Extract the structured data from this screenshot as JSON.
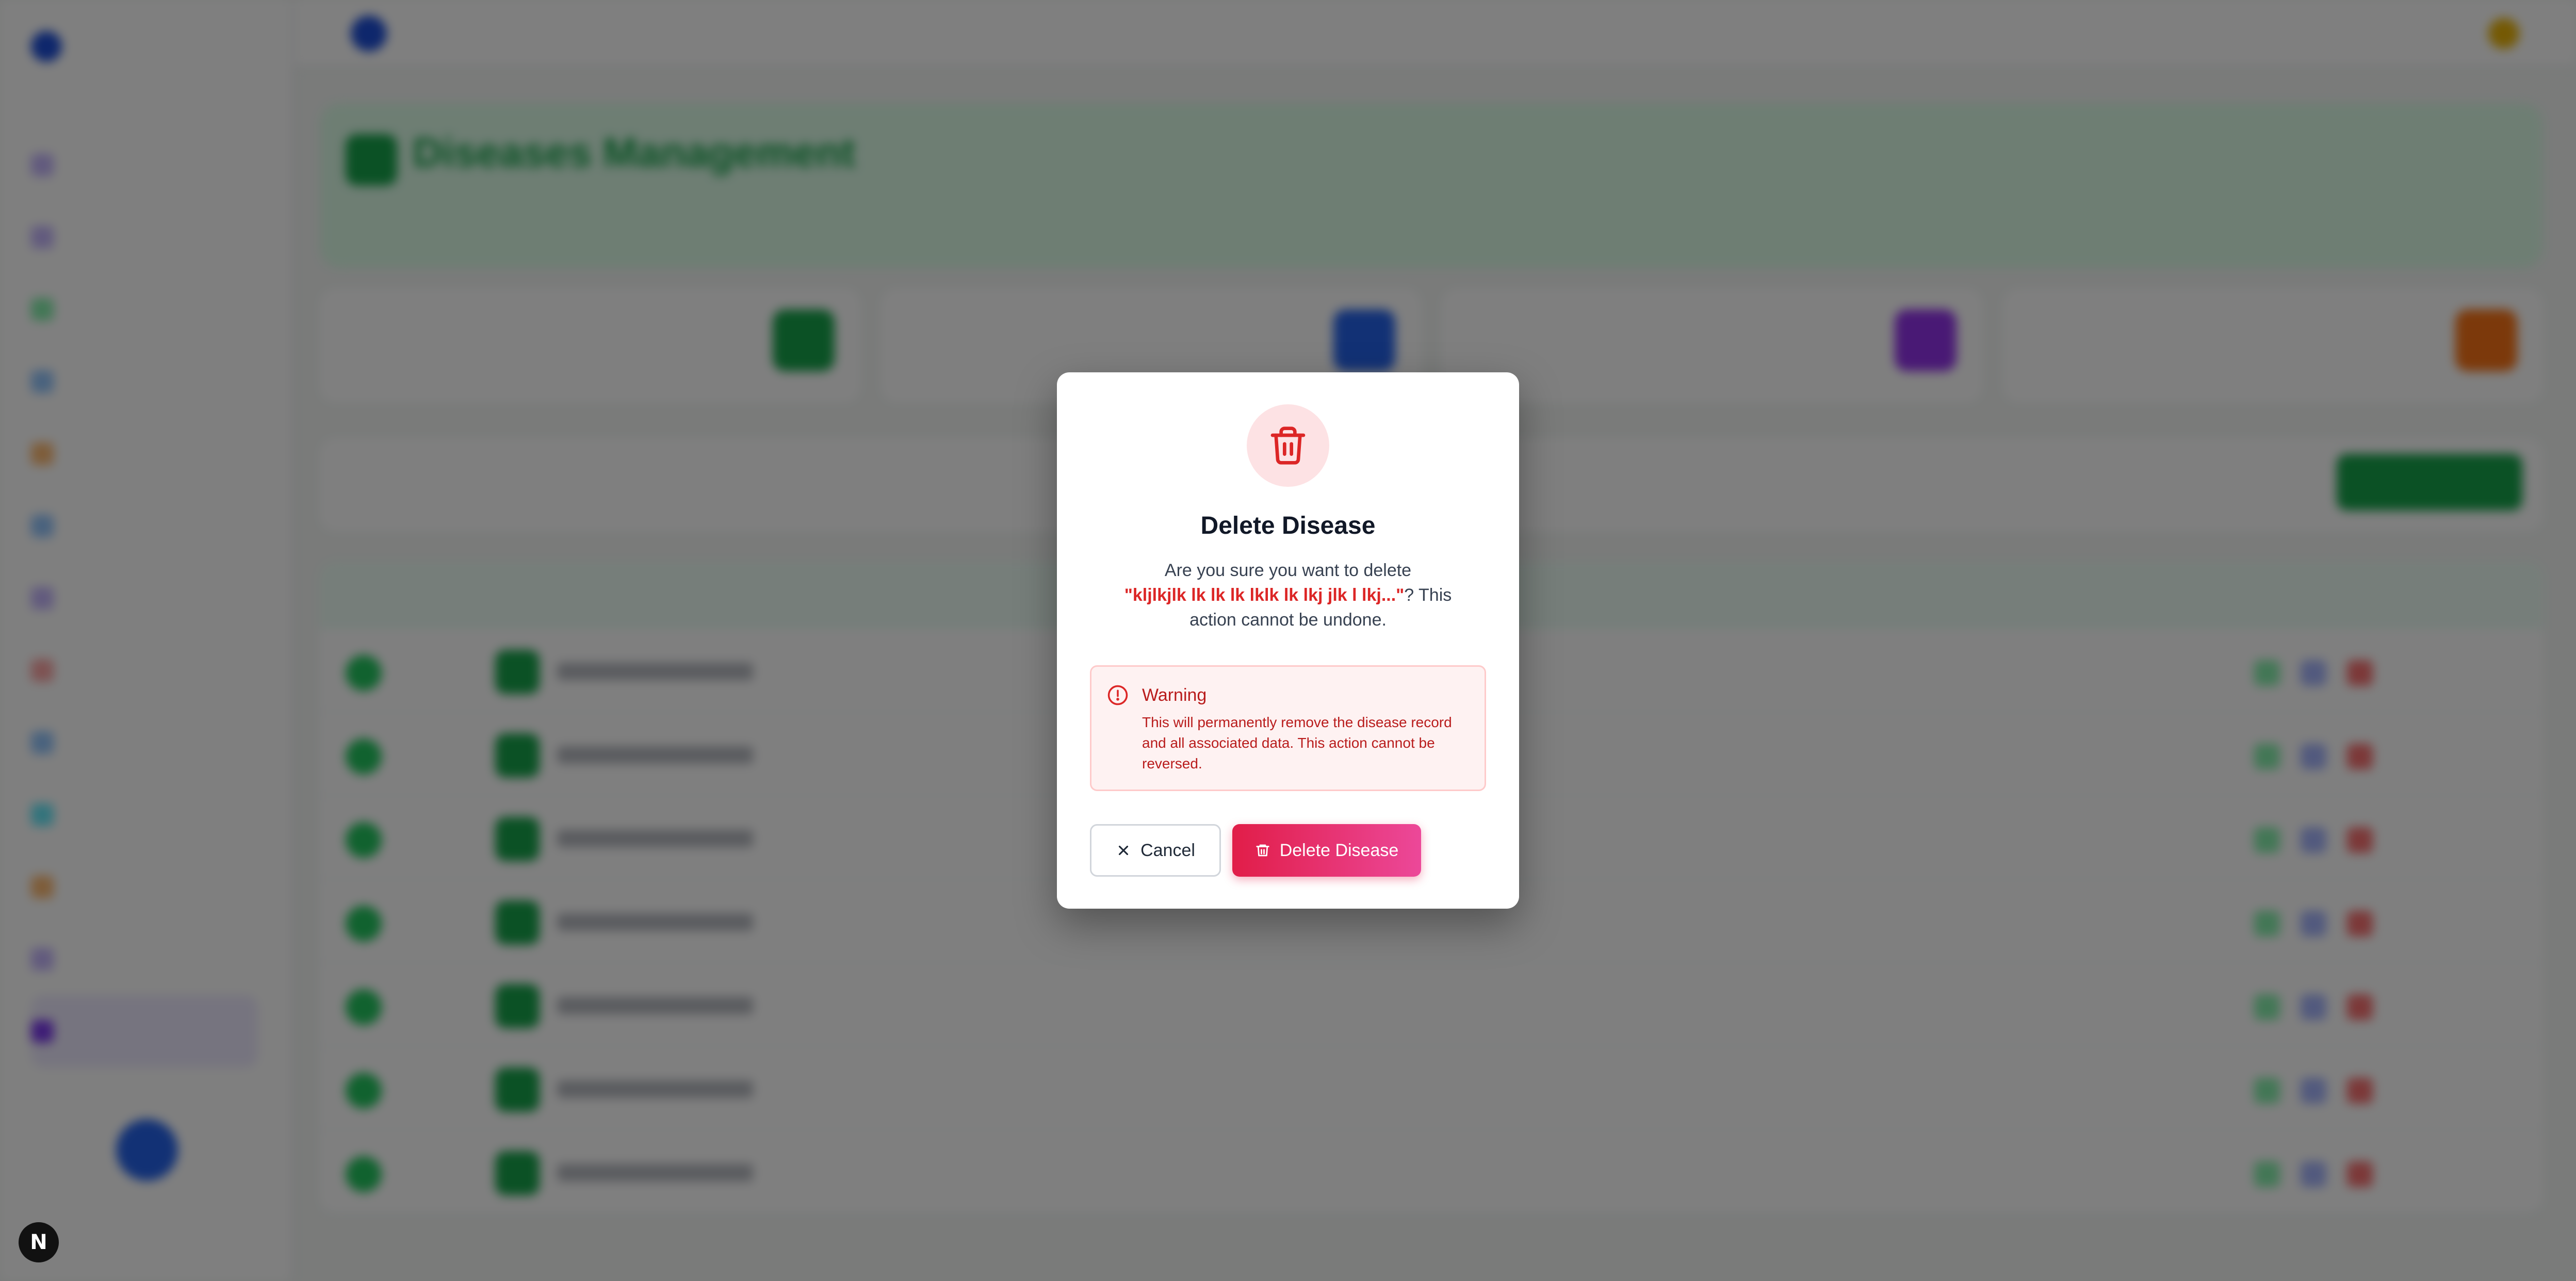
{
  "modal": {
    "title": "Delete Disease",
    "description_prefix": "Are you sure you want to delete",
    "item_name": "\"kljlkjlk lk lk lk lklk lk lkj jlk l lkj...\"",
    "description_suffix": "? This action cannot be undone.",
    "warning_title": "Warning",
    "warning_text": "This will permanently remove the disease record and all associated data. This action cannot be reversed.",
    "cancel_label": "Cancel",
    "delete_label": "Delete Disease"
  },
  "background": {
    "page_title": "Diseases Management",
    "row_count": 7
  },
  "badge": {
    "label": "N"
  },
  "colors": {
    "danger": "#dc2626",
    "danger_gradient_end": "#ec4899",
    "warning_bg": "#fef2f2",
    "overlay": "rgba(0,0,0,0.5)"
  },
  "icons": {
    "header": "trash-icon",
    "warning": "alert-circle-icon",
    "cancel": "close-icon",
    "delete": "trash-icon"
  }
}
